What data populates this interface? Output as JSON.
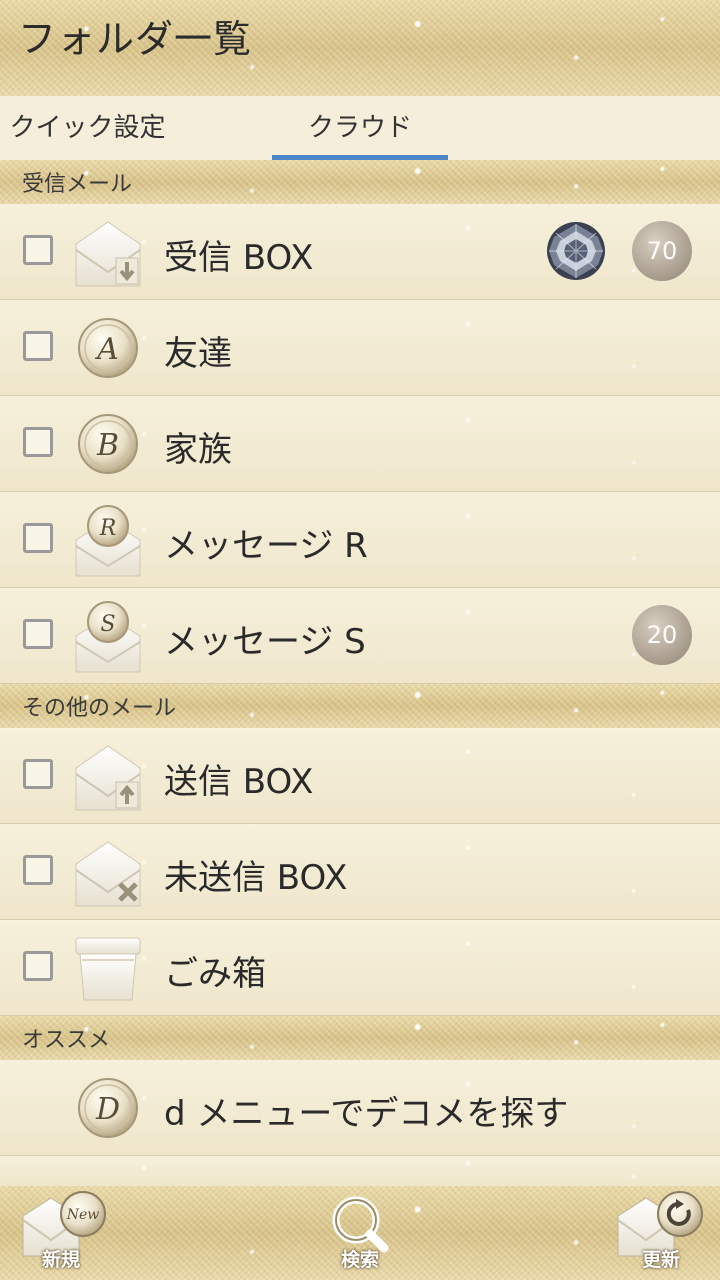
{
  "header": {
    "title": "フォルダ一覧"
  },
  "tabs": [
    {
      "label": "クイック設定"
    },
    {
      "label": "クラウド"
    }
  ],
  "sections": [
    {
      "label": "受信メール"
    },
    {
      "label": "その他のメール"
    },
    {
      "label": "オススメ"
    }
  ],
  "inbox_folders": [
    {
      "label": "受信 BOX",
      "badge": "70",
      "icon": "envelope-download-icon"
    },
    {
      "label": "友達",
      "icon": "coin-letter-a-icon"
    },
    {
      "label": "家族",
      "icon": "coin-letter-b-icon"
    },
    {
      "label": "メッセージ R",
      "icon": "envelope-coin-r-icon"
    },
    {
      "label": "メッセージ S",
      "badge": "20",
      "icon": "envelope-coin-s-icon"
    }
  ],
  "other_folders": [
    {
      "label": "送信 BOX",
      "icon": "envelope-upload-icon"
    },
    {
      "label": "未送信 BOX",
      "icon": "envelope-cancel-icon"
    },
    {
      "label": "ごみ箱",
      "icon": "trash-box-icon"
    }
  ],
  "recommend": [
    {
      "label": "d メニューでデコメを探す",
      "icon": "coin-letter-d-icon"
    }
  ],
  "bottom_nav": [
    {
      "label": "新規",
      "icon": "envelope-new-icon"
    },
    {
      "label": "検索",
      "icon": "search-icon"
    },
    {
      "label": "更新",
      "icon": "refresh-icon"
    }
  ],
  "colors": {
    "tab_underline": "#4a86c8",
    "background": "#f3ecd6",
    "gold": "#d6c186"
  }
}
